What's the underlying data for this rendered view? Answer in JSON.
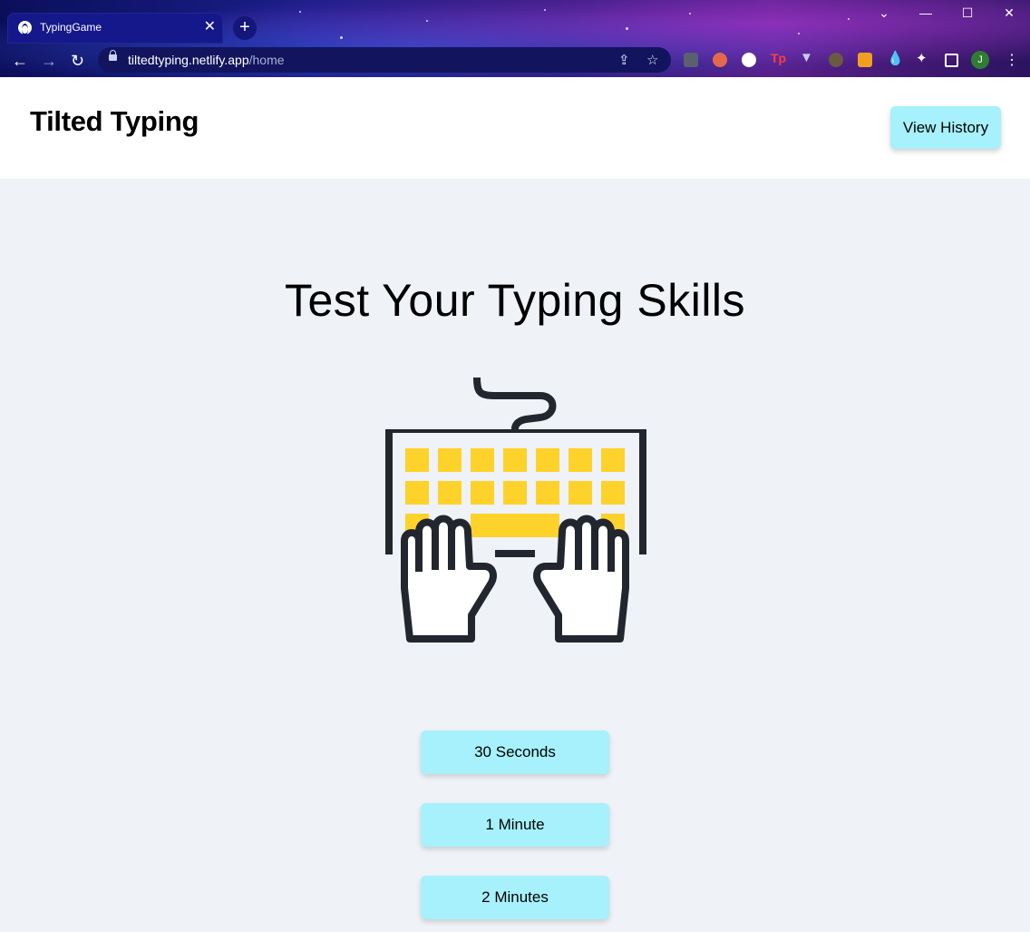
{
  "browser": {
    "tab_title": "TypingGame",
    "url_domain": "tiltedtyping.netlify.app",
    "url_path": "/home",
    "profile_initial": "J"
  },
  "header": {
    "brand": "Tilted Typing",
    "history_button": "View History"
  },
  "main": {
    "headline": "Test Your Typing Skills",
    "illustration_icon": "keyboard-hands-icon",
    "durations": [
      "30 Seconds",
      "1 Minute",
      "2 Minutes"
    ]
  },
  "colors": {
    "button_bg": "#a6f1fb",
    "page_bg": "#eff2f7",
    "keys": "#fdd22b",
    "outline": "#22262e"
  }
}
